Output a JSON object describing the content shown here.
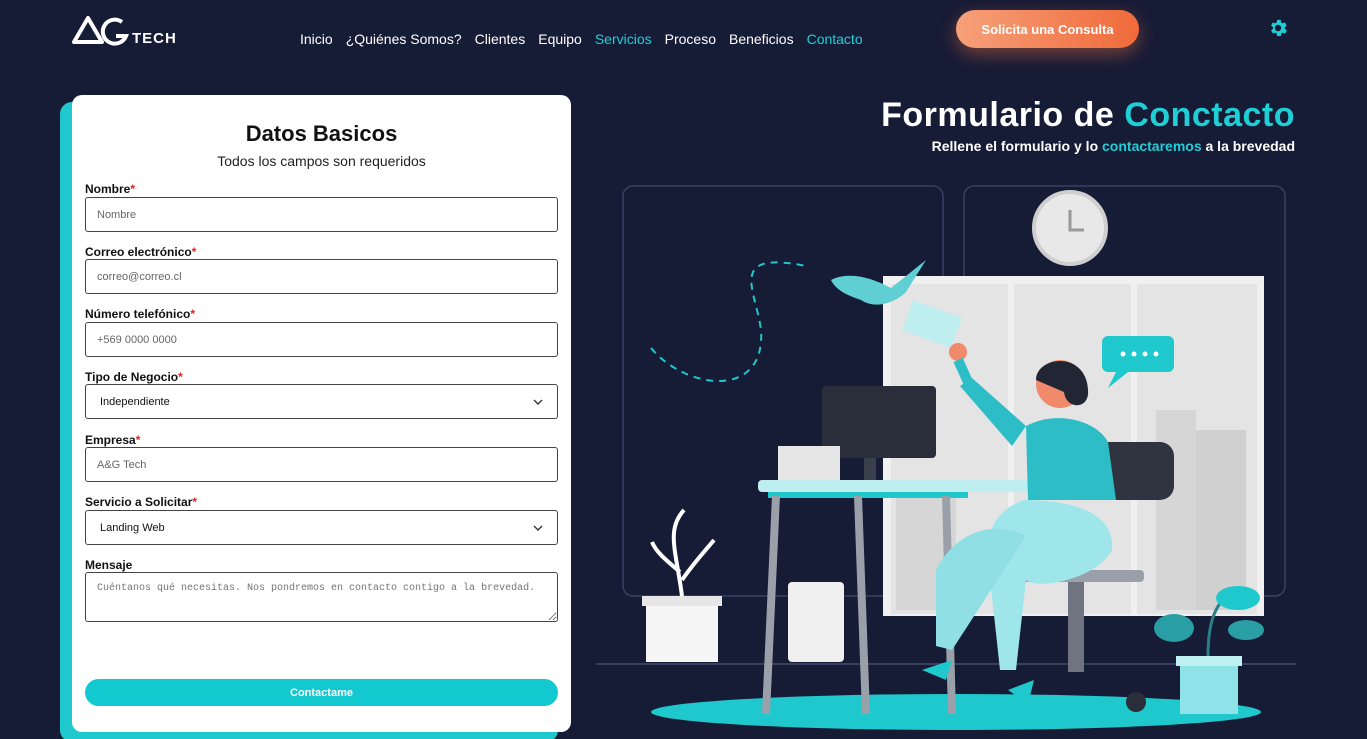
{
  "header": {
    "logo_text": "TECH",
    "nav": [
      {
        "label": "Inicio",
        "active": false
      },
      {
        "label": "¿Quiénes Somos?",
        "active": false
      },
      {
        "label": "Clientes",
        "active": false
      },
      {
        "label": "Equipo",
        "active": false
      },
      {
        "label": "Servicios",
        "active": true
      },
      {
        "label": "Proceso",
        "active": false
      },
      {
        "label": "Beneficios",
        "active": false
      },
      {
        "label": "Contacto",
        "active": true
      }
    ],
    "cta_label": "Solicita una Consulta",
    "settings_icon": "gear-icon"
  },
  "form": {
    "title": "Datos Basicos",
    "subtitle": "Todos los campos son requeridos",
    "fields": {
      "nombre": {
        "label": "Nombre",
        "required_mark": "*",
        "placeholder": "Nombre",
        "value": ""
      },
      "correo": {
        "label": "Correo electrónico",
        "required_mark": "*",
        "placeholder": "correo@correo.cl",
        "value": ""
      },
      "telefono": {
        "label": "Número telefónico",
        "required_mark": "*",
        "placeholder": "+569 0000 0000",
        "value": ""
      },
      "tipo_negocio": {
        "label": "Tipo de Negocio",
        "required_mark": "*",
        "selected": "Independiente"
      },
      "empresa": {
        "label": "Empresa",
        "required_mark": "*",
        "placeholder": "A&G Tech",
        "value": ""
      },
      "servicio": {
        "label": "Servicio a Solicitar",
        "required_mark": "*",
        "selected": "Landing Web"
      },
      "mensaje": {
        "label": "Mensaje",
        "placeholder": "Cuéntanos qué necesitas. Nos pondremos en contacto contigo a la brevedad."
      }
    },
    "submit_label": "Contactame"
  },
  "hero": {
    "title_part1": "Formulario de",
    "title_part2": "Conctacto",
    "subtitle_part1": "Rellene el formulario y lo",
    "subtitle_accent": "contactaremos",
    "subtitle_part2": "a la brevedad"
  },
  "colors": {
    "background": "#161b36",
    "accent": "#1ed0d6",
    "cta_start": "#f6a07a",
    "cta_end": "#f06a3a"
  }
}
